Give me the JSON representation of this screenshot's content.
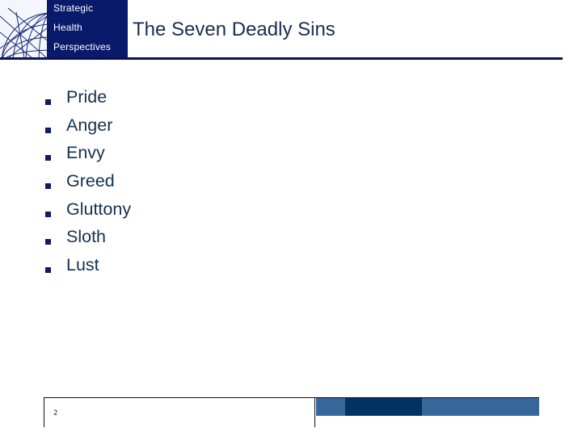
{
  "logo": {
    "lines": [
      "Strategic",
      "Health",
      "Perspectives"
    ],
    "icon": "globe-wireframe-icon",
    "colors": {
      "background": "#0a1a6b",
      "text": "#ffffff"
    }
  },
  "slide": {
    "title": "The Seven Deadly Sins",
    "items": [
      "Pride",
      "Anger",
      "Envy",
      "Greed",
      "Gluttony",
      "Sloth",
      "Lust"
    ],
    "bullet_icon": "square-bullet-icon",
    "colors": {
      "text": "#16304f",
      "bullet": "#101a68",
      "rule": "#0a1455"
    }
  },
  "footer": {
    "page_number": "2",
    "bar_colors": [
      "#36679a",
      "#003262",
      "#36679a"
    ]
  }
}
